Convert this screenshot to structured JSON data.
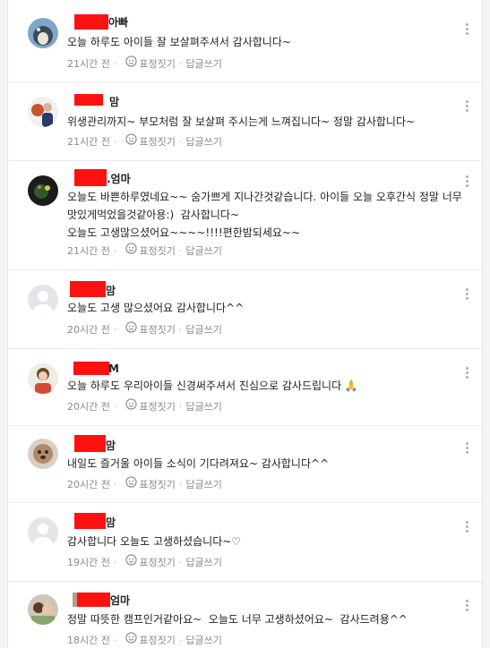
{
  "comments": [
    {
      "author_suffix": "아빠",
      "text": "오늘 하루도 아이들 잘 보살펴주셔서 감사합니다~",
      "time": "21시간 전",
      "react_label": "표정짓기",
      "reply_label": "답글쓰기",
      "avatar_icon": "profile-photo-icon"
    },
    {
      "author_suffix": "맘",
      "text": "위생관리까지~ 부모처럼 잘 보살펴 주시는게 느껴집니다~ 정말 감사합니다~",
      "time": "21시간 전",
      "react_label": "표정짓기",
      "reply_label": "답글쓰기",
      "avatar_icon": "profile-photo-icon"
    },
    {
      "author_suffix": ".엄마",
      "text": "오늘도 바쁜하루였네요~~ 숨가쁘게 지나간것같습니다. 아이들 오늘 오후간식 정말 너무 맛있게먹었을것같아용:)  감사합니다~\n오늘도 고생많으셨어요~~~~!!!!편한밤되세요~~",
      "time": "21시간 전",
      "react_label": "표정짓기",
      "reply_label": "답글쓰기",
      "avatar_icon": "profile-photo-icon"
    },
    {
      "author_suffix": "맘",
      "text": "오늘도 고생 많으셨어요 감사합니다^^",
      "time": "20시간 전",
      "react_label": "표정짓기",
      "reply_label": "답글쓰기",
      "avatar_icon": "default-avatar-icon"
    },
    {
      "author_suffix": "M",
      "text": "오늘 하루도 우리아이들 신경써주셔서 진심으로 감사드립니다 🙏",
      "time": "20시간 전",
      "react_label": "표정짓기",
      "reply_label": "답글쓰기",
      "avatar_icon": "profile-photo-icon"
    },
    {
      "author_suffix": "맘",
      "text": "내일도 즐거울 아이들 소식이 기다려져요~ 감사합니다^^",
      "time": "20시간 전",
      "react_label": "표정짓기",
      "reply_label": "답글쓰기",
      "avatar_icon": "profile-photo-icon"
    },
    {
      "author_suffix": "맘",
      "text": "감사합니다 오늘도 고생하셨습니다~♡",
      "time": "19시간 전",
      "react_label": "표정짓기",
      "reply_label": "답글쓰기",
      "avatar_icon": "default-avatar-icon"
    },
    {
      "author_suffix": "엄마",
      "text": "정말 따뜻한 캠프인거같아요~  오늘도 너무 고생하셨어요~  감사드려용^^",
      "time": "18시간 전",
      "react_label": "표정짓기",
      "reply_label": "답글쓰기",
      "avatar_icon": "profile-photo-icon"
    }
  ],
  "colors": {
    "redaction": "#ff1111",
    "meta_text": "#8a8a8a",
    "divider": "#ececec"
  }
}
